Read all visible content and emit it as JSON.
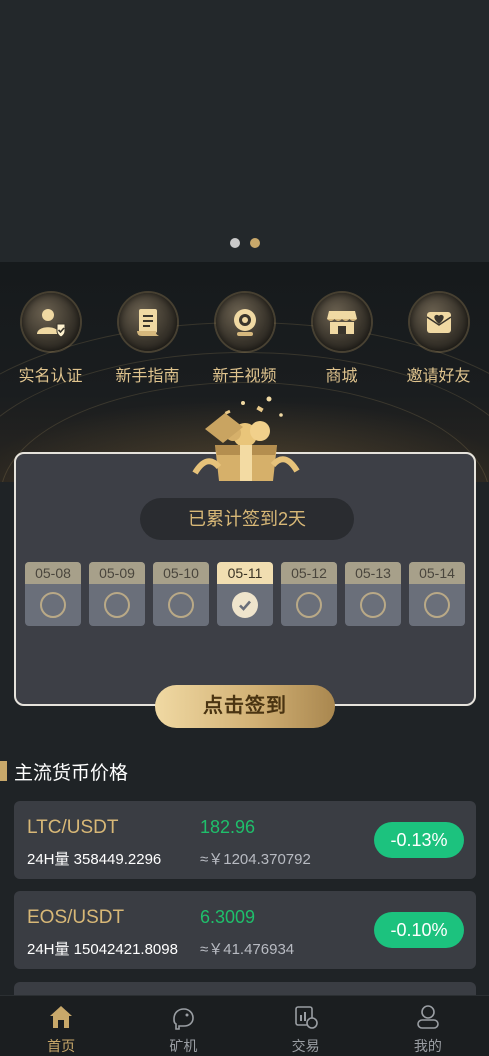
{
  "banner": {
    "dots": 2,
    "active_dot": 1
  },
  "quick_menu": [
    {
      "label": "实名认证",
      "icon": "id-verify-icon"
    },
    {
      "label": "新手指南",
      "icon": "guide-scroll-icon"
    },
    {
      "label": "新手视频",
      "icon": "camera-icon"
    },
    {
      "label": "商城",
      "icon": "shop-icon"
    },
    {
      "label": "邀请好友",
      "icon": "invite-heart-icon"
    }
  ],
  "checkin": {
    "summary": "已累计签到2天",
    "days": [
      {
        "date": "05-08",
        "checked": false
      },
      {
        "date": "05-09",
        "checked": false
      },
      {
        "date": "05-10",
        "checked": false
      },
      {
        "date": "05-11",
        "checked": true
      },
      {
        "date": "05-12",
        "checked": false
      },
      {
        "date": "05-13",
        "checked": false
      },
      {
        "date": "05-14",
        "checked": false
      }
    ],
    "button": "点击签到"
  },
  "market": {
    "title": "主流货币价格",
    "coins": [
      {
        "pair": "LTC/USDT",
        "volume": "24H量 358449.2296",
        "price": "182.96",
        "cny": "≈￥1204.370792",
        "change": "-0.13%"
      },
      {
        "pair": "EOS/USDT",
        "volume": "24H量 15042421.8098",
        "price": "6.3009",
        "cny": "≈￥41.476934",
        "change": "-0.10%"
      }
    ]
  },
  "tabbar": [
    {
      "label": "首页",
      "icon": "home-icon",
      "active": true
    },
    {
      "label": "矿机",
      "icon": "mining-icon",
      "active": false
    },
    {
      "label": "交易",
      "icon": "trade-icon",
      "active": false
    },
    {
      "label": "我的",
      "icon": "profile-icon",
      "active": false
    }
  ],
  "colors": {
    "gold": "#c8a86a",
    "up_green": "#1cc27e",
    "bg": "#1f2326"
  }
}
